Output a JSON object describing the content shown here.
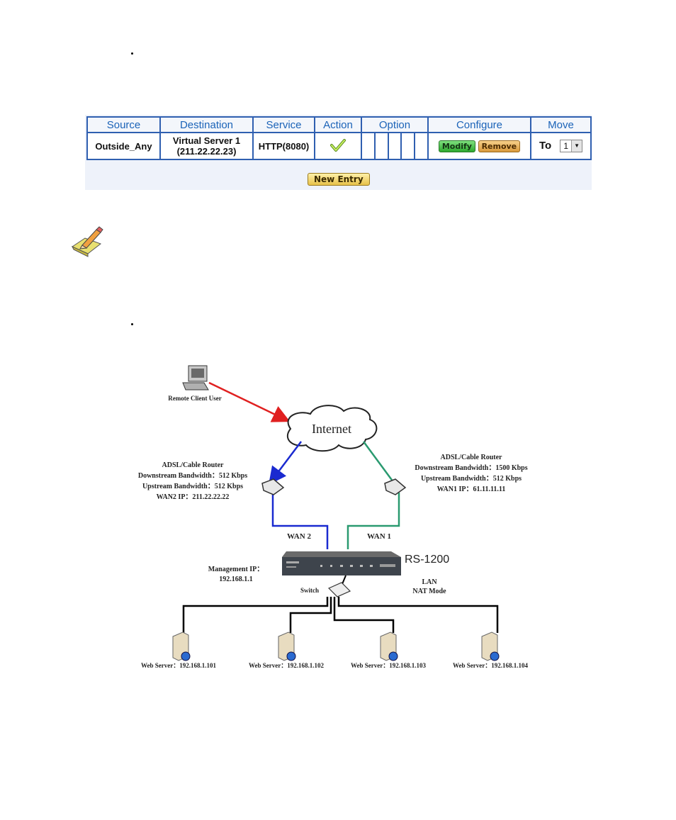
{
  "policy_table": {
    "headers": [
      "Source",
      "Destination",
      "Service",
      "Action",
      "Option",
      "Configure",
      "Move"
    ],
    "row": {
      "source": "Outside_Any",
      "destination_line1": "Virtual Server 1",
      "destination_line2": "(211.22.22.23)",
      "service": "HTTP(8080)",
      "action": "check-icon",
      "configure": {
        "modify_label": "Modify",
        "remove_label": "Remove"
      },
      "move": {
        "prefix": "To",
        "selected": "1"
      }
    },
    "new_entry_label": "New Entry",
    "colors": {
      "border": "#2f5fb0",
      "header_text": "#1b63b8",
      "panel_bg": "#eef2fa"
    }
  },
  "diagram": {
    "remote_client": "Remote Client User",
    "internet": "Internet",
    "router_left": {
      "title": "ADSL/Cable Router",
      "downstream": "Downstream Bandwidth：512 Kbps",
      "upstream": "Upstream Bandwidth：512 Kbps",
      "wan_ip": "WAN2 IP：211.22.22.22"
    },
    "router_right": {
      "title": "ADSL/Cable Router",
      "downstream": "Downstream Bandwidth：1500 Kbps",
      "upstream": "Upstream Bandwidth：512 Kbps",
      "wan_ip": "WAN1 IP：61.11.11.11"
    },
    "wan2_label": "WAN 2",
    "wan1_label": "WAN 1",
    "device_name": "RS-1200",
    "management_ip_line1": "Management IP：",
    "management_ip_line2": "192.168.1.1",
    "switch_label": "Switch",
    "lan_line1": "LAN",
    "lan_line2": "NAT Mode",
    "servers": [
      "Web Server：192.168.1.101",
      "Web Server：192.168.1.102",
      "Web Server：192.168.1.103",
      "Web Server：192.168.1.104"
    ],
    "colors": {
      "client_link": "#e02020",
      "wan2_link": "#1a2ad0",
      "wan1_link": "#2a9a70",
      "lan_link": "#000000"
    }
  }
}
